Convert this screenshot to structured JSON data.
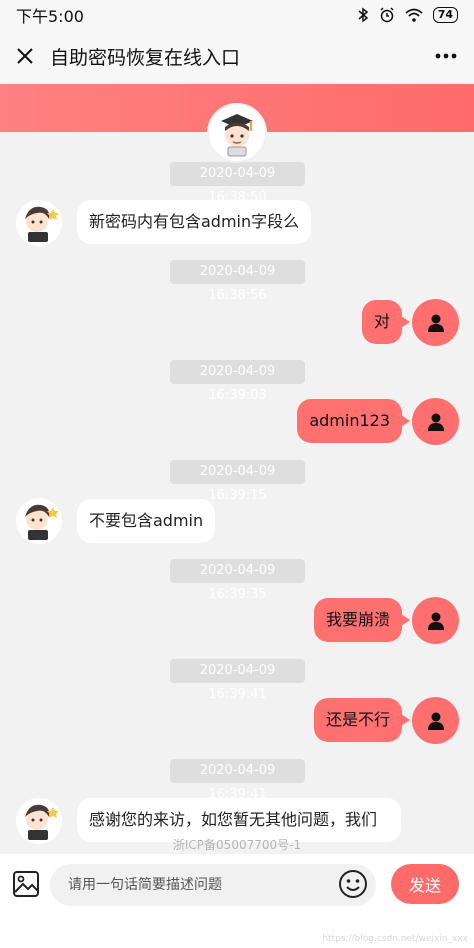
{
  "status_bar": {
    "time": "下午5:00",
    "battery": "74"
  },
  "header": {
    "title": "自助密码恢复在线入口"
  },
  "messages": [
    {
      "time": "2020-04-09 16:38:50"
    },
    {
      "side": "left",
      "text": "新密码内有包含admin字段么"
    },
    {
      "time": "2020-04-09 16:38:56"
    },
    {
      "side": "right",
      "text": "对"
    },
    {
      "time": "2020-04-09 16:39:03"
    },
    {
      "side": "right",
      "text": "admin123"
    },
    {
      "time": "2020-04-09 16:39:15"
    },
    {
      "side": "left",
      "text": "不要包含admin"
    },
    {
      "time": "2020-04-09 16:39:35"
    },
    {
      "side": "right",
      "text": "我要崩溃"
    },
    {
      "time": "2020-04-09 16:39:41"
    },
    {
      "side": "right",
      "text": "还是不行"
    },
    {
      "time": "2020-04-09 16:39:41"
    },
    {
      "side": "left",
      "text": "感谢您的来访，如您暂无其他问题，我们"
    }
  ],
  "footer": {
    "icp": "浙ICP备05007700号-1"
  },
  "input": {
    "placeholder": "请用一句话简要描述问题",
    "send_label": "发送"
  },
  "watermark": "https://blog.csdn.net/weixin_xxx",
  "colors": {
    "accent": "#ff6b6b",
    "bubble_right": "#ff7070",
    "background": "#f2f2f2"
  },
  "icons": [
    "close-icon",
    "more-icon",
    "bluetooth-icon",
    "alarm-icon",
    "wifi-icon",
    "user-icon",
    "image-icon",
    "emoji-icon"
  ]
}
